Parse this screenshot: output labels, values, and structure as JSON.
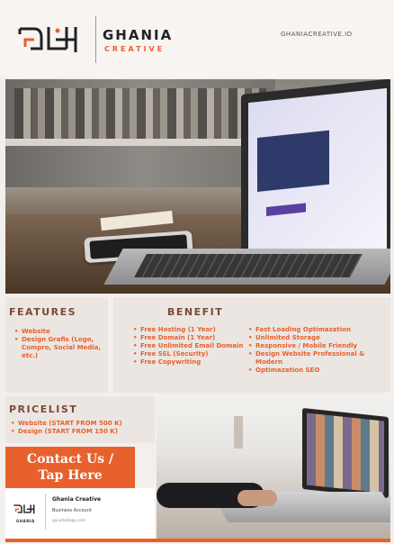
{
  "header": {
    "brand_name": "GHANIA",
    "brand_sub": "CREATIVE",
    "website": "GHANIACREATIVE.ID"
  },
  "features": {
    "title": "FEATURES",
    "items": [
      "Website",
      "Design Grafis (Logo, Compro, Social Media, etc.)"
    ]
  },
  "benefit": {
    "title": "BENEFIT",
    "col1": [
      "Free Hosting (1 Year)",
      "Free Domain (1 Year)",
      "Free Unlimited Email Domain",
      "Free SSL (Security)",
      "Free Copywriting"
    ],
    "col2": [
      "Fast Loading Optimazation",
      "Unlimited Storage",
      "Responsive / Mobile Friendly",
      "Design Website Professional & Modern",
      "Optimazation SEO"
    ]
  },
  "pricelist": {
    "title": "PRICELIST",
    "items": [
      "Website (START FROM 500 K)",
      "Design (START FROM 150 K)"
    ]
  },
  "contact": {
    "line1": "Contact Us /",
    "line2": "Tap Here"
  },
  "card": {
    "logo_text": "GHANIA",
    "name": "Ghania Creative",
    "type": "Business Account",
    "url": "api.whatsapp.com"
  },
  "colors": {
    "accent": "#e8612c",
    "heading": "#7a4a36",
    "panel": "#ebe6e2"
  }
}
